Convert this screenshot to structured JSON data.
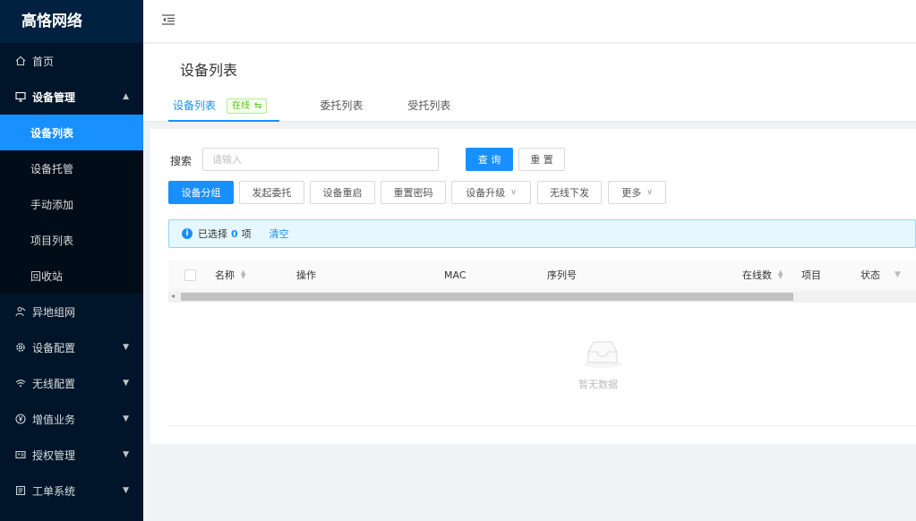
{
  "app": {
    "logo": "高恪网络"
  },
  "sidebar": {
    "items": [
      {
        "label": "首页",
        "icon": "home-icon"
      },
      {
        "label": "设备管理",
        "icon": "monitor-icon",
        "expanded": true,
        "children": [
          {
            "label": "设备列表",
            "active": true
          },
          {
            "label": "设备托管"
          },
          {
            "label": "手动添加"
          },
          {
            "label": "项目列表"
          },
          {
            "label": "回收站"
          }
        ]
      },
      {
        "label": "异地组网",
        "icon": "network-icon"
      },
      {
        "label": "设备配置",
        "icon": "gear-icon"
      },
      {
        "label": "无线配置",
        "icon": "wifi-icon"
      },
      {
        "label": "增值业务",
        "icon": "yen-icon"
      },
      {
        "label": "授权管理",
        "icon": "id-card-icon"
      },
      {
        "label": "工单系统",
        "icon": "ticket-icon"
      }
    ]
  },
  "page": {
    "title": "设备列表",
    "tabs": [
      {
        "label": "设备列表",
        "badge": "在线",
        "badge_icon": "swap-icon",
        "active": true
      },
      {
        "label": "委托列表"
      },
      {
        "label": "受托列表"
      }
    ]
  },
  "search": {
    "label": "搜索",
    "placeholder": "请输入",
    "value": "",
    "query_button": "查 询",
    "reset_button": "重 置"
  },
  "toolbar": {
    "group_button": "设备分组",
    "delegate_button": "发起委托",
    "reboot_button": "设备重启",
    "reset_password_button": "重置密码",
    "upgrade_button": "设备升级",
    "wireless_deploy_button": "无线下发",
    "more_button": "更多"
  },
  "selection": {
    "prefix": "已选择",
    "count": "0",
    "suffix": "项",
    "clear_label": "清空"
  },
  "table": {
    "columns": [
      "名称",
      "操作",
      "MAC",
      "序列号",
      "在线数",
      "项目",
      "状态"
    ],
    "empty_text": "暂无数据"
  },
  "colors": {
    "sidebar_bg": "#001529",
    "primary": "#1890ff",
    "online_badge": "#52c41a"
  }
}
